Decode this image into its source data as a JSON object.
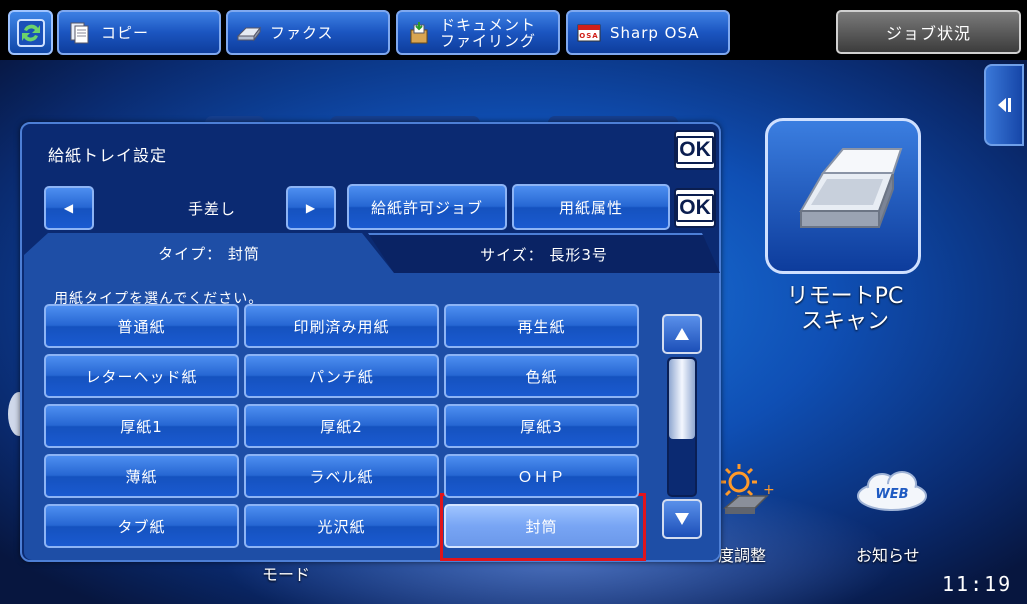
{
  "topbar": {
    "modes": [
      {
        "label": "コピー",
        "icon": "copy-icon"
      },
      {
        "label": "ファクス",
        "icon": "fax-icon"
      },
      {
        "label_line1": "ドキュメント",
        "label_line2": "ファイリング",
        "icon": "document-filing-icon"
      },
      {
        "label": "Sharp OSA",
        "icon": "osa-icon",
        "icon_text": "OSA"
      }
    ],
    "job_status": "ジョブ状況"
  },
  "background": {
    "remote_scan": {
      "line1": "リモートPC",
      "line2": "スキャン"
    },
    "brightness_label": "度調整",
    "notice_label": "お知らせ",
    "mode_label": "モード",
    "web_icon_text": "WEB",
    "clock": "11:19"
  },
  "dialog": {
    "title": "給紙トレイ設定",
    "ok_label": "OK",
    "tray": "手差し",
    "prev_arrow": "◀",
    "next_arrow": "▶",
    "allowed_jobs_label": "給紙許可ジョブ",
    "paper_attr_label": "用紙属性",
    "tab_type": "タイプ：  封筒",
    "tab_size": "サイズ：  長形3号",
    "instruction": "用紙タイプを選んでください。",
    "paper_types": [
      "普通紙",
      "印刷済み用紙",
      "再生紙",
      "レターヘッド紙",
      "パンチ紙",
      "色紙",
      "厚紙1",
      "厚紙2",
      "厚紙3",
      "薄紙",
      "ラベル紙",
      "ＯＨＰ",
      "タブ紙",
      "光沢紙",
      "封筒"
    ],
    "selected": "封筒",
    "scroll_position": 0.0
  },
  "colors": {
    "accent": "#2667d3",
    "selected": "#78a5f4",
    "highlight_frame": "#e0141b"
  }
}
